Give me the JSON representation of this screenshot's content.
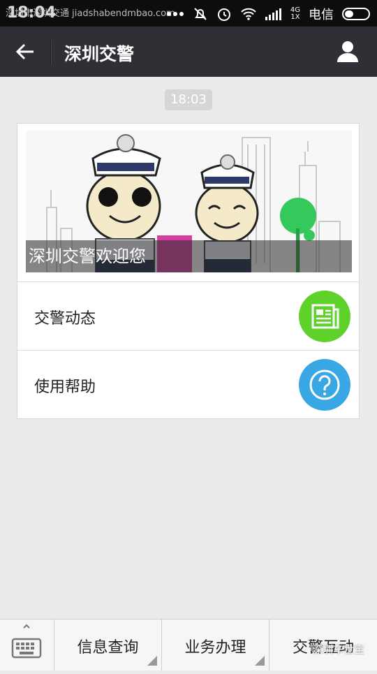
{
  "status_bar": {
    "time": "18:04",
    "watermark": "深圳市深圳交通  jiadshabendmbao.com",
    "network": "4G\n1X",
    "carrier": "电信"
  },
  "header": {
    "title": "深圳交警"
  },
  "timestamp": "18:03",
  "card": {
    "banner_caption": "深圳交警欢迎您",
    "items": [
      {
        "label": "交警动态",
        "icon": "news-icon",
        "icon_color": "#5ed12a"
      },
      {
        "label": "使用帮助",
        "icon": "help-icon",
        "icon_color": "#3aa7e5"
      }
    ]
  },
  "bottom_bar": {
    "keyboard_icon": "keyboard-icon",
    "tabs": [
      {
        "label": "信息查询"
      },
      {
        "label": "业务办理"
      },
      {
        "label": "交警互动"
      }
    ],
    "watermark": "深圳车世宝"
  },
  "colors": {
    "title_bar": "#2e3035",
    "status_bar": "#0d0d0d",
    "background": "#ebebeb"
  }
}
